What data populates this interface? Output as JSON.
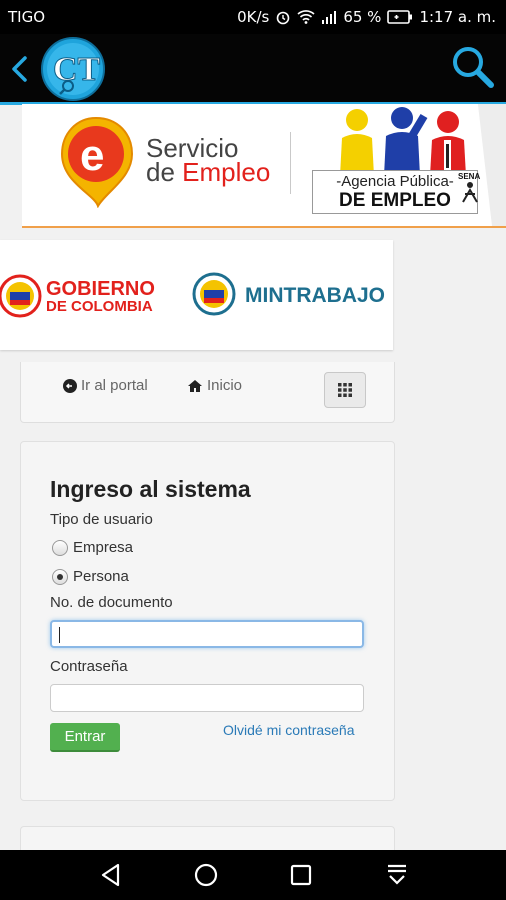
{
  "status_bar": {
    "carrier": "TIGO",
    "speed": "0K/s",
    "battery_percent": "65 %",
    "time": "1:17 a. m."
  },
  "app_bar": {
    "logo_text": "CT"
  },
  "banner": {
    "servicio_line1": "Servicio",
    "servicio_de": "de",
    "servicio_empleo": "Empleo",
    "agency_line1": "-Agencia Pública-",
    "agency_line2": "DE EMPLEO",
    "sena": "SENA"
  },
  "gov": {
    "gobierno_line1": "GOBIERNO",
    "gobierno_line2": "DE COLOMBIA",
    "mintrabajo": "MINTRABAJO"
  },
  "nav": {
    "portal_label": "Ir al portal",
    "home_label": "Inicio"
  },
  "login": {
    "title": "Ingreso al sistema",
    "user_type_label": "Tipo de usuario",
    "option_empresa": "Empresa",
    "option_persona": "Persona",
    "selected_option": "Persona",
    "document_label": "No. de documento",
    "document_value": "",
    "password_label": "Contraseña",
    "password_value": "",
    "submit_label": "Entrar",
    "forgot_label": "Olvidé mi contraseña"
  },
  "colors": {
    "accent_blue": "#27a9e1",
    "submit_green": "#52b04f",
    "link_blue": "#2a7ab7",
    "brand_red": "#e2211c"
  }
}
